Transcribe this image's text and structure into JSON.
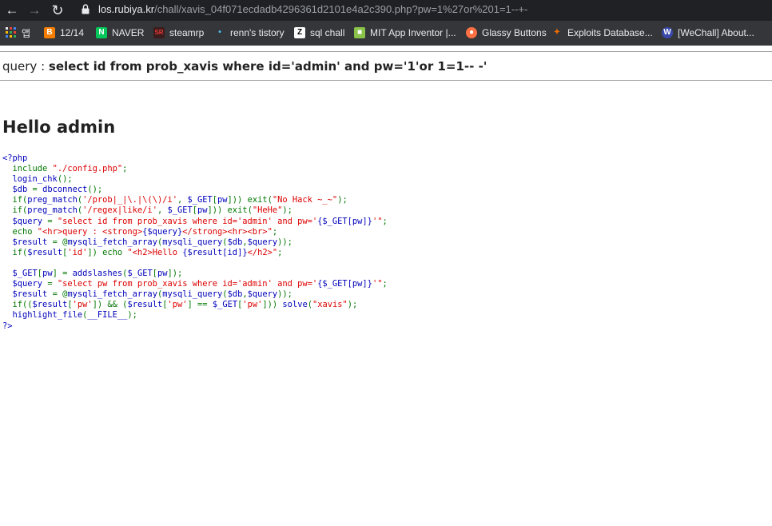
{
  "browser": {
    "url_host": "los.rubiya.kr",
    "url_path": "/chall/xavis_04f071ecdadb4296361d2101e4a2c390.php?pw=1%27or%201=1--+-",
    "bookmarks": [
      {
        "label": "앱",
        "icon": "apps-grid-icon",
        "color": "#e8eaed"
      },
      {
        "label": "12/14",
        "icon": "blogger-icon",
        "color": "#f57d00"
      },
      {
        "label": "NAVER",
        "icon": "naver-icon",
        "color": "#03c75a"
      },
      {
        "label": "steamrp",
        "icon": "steamrp-icon",
        "color": "#c62828"
      },
      {
        "label": "renn's tistory",
        "icon": "tistory-icon",
        "color": "#4fc3f7"
      },
      {
        "label": "sql chall",
        "icon": "z-icon",
        "color": "#ffffff"
      },
      {
        "label": "MIT App Inventor |...",
        "icon": "app-inventor-icon",
        "color": "#8bc34a"
      },
      {
        "label": "Glassy Buttons",
        "icon": "glassy-icon",
        "color": "#ff7043"
      },
      {
        "label": "Exploits Database...",
        "icon": "exploit-db-icon",
        "color": "#ef6c00"
      },
      {
        "label": "[WeChall] About...",
        "icon": "wechall-icon",
        "color": "#3949ab"
      }
    ]
  },
  "page": {
    "query_label": "query : ",
    "query_value": "select id from prob_xavis where id='admin' and pw='1'or 1=1-- -'",
    "hello": "Hello admin"
  },
  "source_lines": [
    [
      {
        "t": "<?php",
        "c": "def"
      }
    ],
    [
      {
        "t": "  include ",
        "c": "kw"
      },
      {
        "t": "\"./config.php\"",
        "c": "str"
      },
      {
        "t": ";",
        "c": "kw"
      }
    ],
    [
      {
        "t": "  login_chk",
        "c": "def"
      },
      {
        "t": "();",
        "c": "kw"
      }
    ],
    [
      {
        "t": "  $db ",
        "c": "def"
      },
      {
        "t": "= ",
        "c": "kw"
      },
      {
        "t": "dbconnect",
        "c": "def"
      },
      {
        "t": "();",
        "c": "kw"
      }
    ],
    [
      {
        "t": "  if(",
        "c": "kw"
      },
      {
        "t": "preg_match",
        "c": "def"
      },
      {
        "t": "(",
        "c": "kw"
      },
      {
        "t": "'/prob|_|\\.|\\(\\)/i'",
        "c": "str"
      },
      {
        "t": ", ",
        "c": "kw"
      },
      {
        "t": "$_GET",
        "c": "def"
      },
      {
        "t": "[",
        "c": "kw"
      },
      {
        "t": "pw",
        "c": "def"
      },
      {
        "t": "])) exit(",
        "c": "kw"
      },
      {
        "t": "\"No Hack ~_~\"",
        "c": "str"
      },
      {
        "t": ");",
        "c": "kw"
      }
    ],
    [
      {
        "t": "  if(",
        "c": "kw"
      },
      {
        "t": "preg_match",
        "c": "def"
      },
      {
        "t": "(",
        "c": "kw"
      },
      {
        "t": "'/regex|like/i'",
        "c": "str"
      },
      {
        "t": ", ",
        "c": "kw"
      },
      {
        "t": "$_GET",
        "c": "def"
      },
      {
        "t": "[",
        "c": "kw"
      },
      {
        "t": "pw",
        "c": "def"
      },
      {
        "t": "])) exit(",
        "c": "kw"
      },
      {
        "t": "\"HeHe\"",
        "c": "str"
      },
      {
        "t": ");",
        "c": "kw"
      }
    ],
    [
      {
        "t": "  $query ",
        "c": "def"
      },
      {
        "t": "= ",
        "c": "kw"
      },
      {
        "t": "\"select id from prob_xavis where id='admin' and pw='",
        "c": "str"
      },
      {
        "t": "{$_GET[pw]}",
        "c": "def"
      },
      {
        "t": "'\"",
        "c": "str"
      },
      {
        "t": ";",
        "c": "kw"
      }
    ],
    [
      {
        "t": "  echo ",
        "c": "kw"
      },
      {
        "t": "\"<hr>query : <strong>",
        "c": "str"
      },
      {
        "t": "{$query}",
        "c": "def"
      },
      {
        "t": "</strong><hr><br>\"",
        "c": "str"
      },
      {
        "t": ";",
        "c": "kw"
      }
    ],
    [
      {
        "t": "  $result ",
        "c": "def"
      },
      {
        "t": "= @",
        "c": "kw"
      },
      {
        "t": "mysqli_fetch_array",
        "c": "def"
      },
      {
        "t": "(",
        "c": "kw"
      },
      {
        "t": "mysqli_query",
        "c": "def"
      },
      {
        "t": "(",
        "c": "kw"
      },
      {
        "t": "$db",
        "c": "def"
      },
      {
        "t": ",",
        "c": "kw"
      },
      {
        "t": "$query",
        "c": "def"
      },
      {
        "t": "));",
        "c": "kw"
      }
    ],
    [
      {
        "t": "  if(",
        "c": "kw"
      },
      {
        "t": "$result",
        "c": "def"
      },
      {
        "t": "[",
        "c": "kw"
      },
      {
        "t": "'id'",
        "c": "str"
      },
      {
        "t": "]) echo ",
        "c": "kw"
      },
      {
        "t": "\"<h2>Hello ",
        "c": "str"
      },
      {
        "t": "{$result[id]}",
        "c": "def"
      },
      {
        "t": "</h2>\"",
        "c": "str"
      },
      {
        "t": ";",
        "c": "kw"
      }
    ],
    [
      {
        "t": "",
        "c": "kw"
      }
    ],
    [
      {
        "t": "  $_GET",
        "c": "def"
      },
      {
        "t": "[",
        "c": "kw"
      },
      {
        "t": "pw",
        "c": "def"
      },
      {
        "t": "] = ",
        "c": "kw"
      },
      {
        "t": "addslashes",
        "c": "def"
      },
      {
        "t": "(",
        "c": "kw"
      },
      {
        "t": "$_GET",
        "c": "def"
      },
      {
        "t": "[",
        "c": "kw"
      },
      {
        "t": "pw",
        "c": "def"
      },
      {
        "t": "]);",
        "c": "kw"
      }
    ],
    [
      {
        "t": "  $query ",
        "c": "def"
      },
      {
        "t": "= ",
        "c": "kw"
      },
      {
        "t": "\"select pw from prob_xavis where id='admin' and pw='",
        "c": "str"
      },
      {
        "t": "{$_GET[pw]}",
        "c": "def"
      },
      {
        "t": "'\"",
        "c": "str"
      },
      {
        "t": ";",
        "c": "kw"
      }
    ],
    [
      {
        "t": "  $result ",
        "c": "def"
      },
      {
        "t": "= @",
        "c": "kw"
      },
      {
        "t": "mysqli_fetch_array",
        "c": "def"
      },
      {
        "t": "(",
        "c": "kw"
      },
      {
        "t": "mysqli_query",
        "c": "def"
      },
      {
        "t": "(",
        "c": "kw"
      },
      {
        "t": "$db",
        "c": "def"
      },
      {
        "t": ",",
        "c": "kw"
      },
      {
        "t": "$query",
        "c": "def"
      },
      {
        "t": "));",
        "c": "kw"
      }
    ],
    [
      {
        "t": "  if((",
        "c": "kw"
      },
      {
        "t": "$result",
        "c": "def"
      },
      {
        "t": "[",
        "c": "kw"
      },
      {
        "t": "'pw'",
        "c": "str"
      },
      {
        "t": "]) && (",
        "c": "kw"
      },
      {
        "t": "$result",
        "c": "def"
      },
      {
        "t": "[",
        "c": "kw"
      },
      {
        "t": "'pw'",
        "c": "str"
      },
      {
        "t": "] == ",
        "c": "kw"
      },
      {
        "t": "$_GET",
        "c": "def"
      },
      {
        "t": "[",
        "c": "kw"
      },
      {
        "t": "'pw'",
        "c": "str"
      },
      {
        "t": "])) ",
        "c": "kw"
      },
      {
        "t": "solve",
        "c": "def"
      },
      {
        "t": "(",
        "c": "kw"
      },
      {
        "t": "\"xavis\"",
        "c": "str"
      },
      {
        "t": ");",
        "c": "kw"
      }
    ],
    [
      {
        "t": "  highlight_file",
        "c": "def"
      },
      {
        "t": "(",
        "c": "kw"
      },
      {
        "t": "__FILE__",
        "c": "def"
      },
      {
        "t": ");",
        "c": "kw"
      }
    ],
    [
      {
        "t": "?>",
        "c": "def"
      }
    ]
  ]
}
